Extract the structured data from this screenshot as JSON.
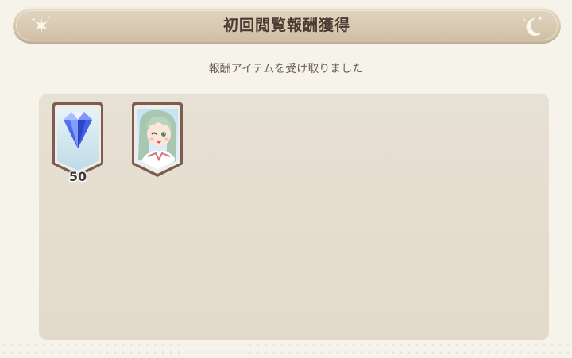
{
  "header": {
    "title": "初回閲覧報酬獲得",
    "left_icon": "sun-sparkle-icon",
    "right_icon": "moon-star-icon"
  },
  "message": "報酬アイテムを受け取りました",
  "rewards": [
    {
      "item": "diamond-gem-icon",
      "count": "50"
    },
    {
      "item": "character-portrait"
    }
  ],
  "colors": {
    "banner": "#d8c9b1",
    "title_text": "#4a3b33",
    "panel": "#e5ddd0",
    "frame": "#7a5a4e"
  }
}
